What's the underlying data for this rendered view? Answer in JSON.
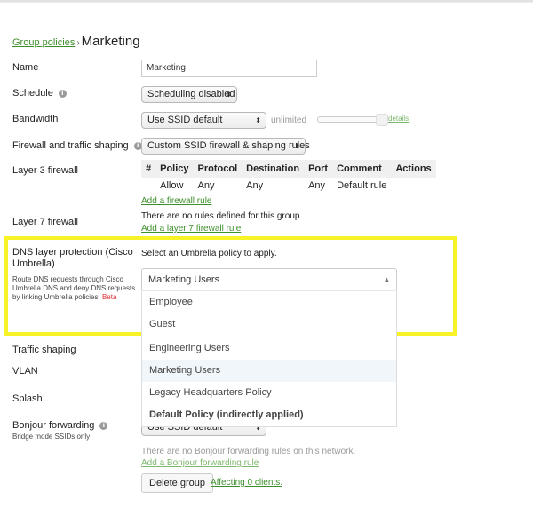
{
  "breadcrumb": {
    "parent_link": "Group policies",
    "separator": "›",
    "current": "Marketing"
  },
  "fields": {
    "name": {
      "label": "Name",
      "value": "Marketing"
    },
    "schedule": {
      "label": "Schedule",
      "value": "Scheduling disabled"
    },
    "bandwidth": {
      "label": "Bandwidth",
      "value": "Use SSID default",
      "limit_text": "unlimited",
      "details_link": "details"
    },
    "firewall_shaping": {
      "label": "Firewall and traffic shaping",
      "value": "Custom SSID firewall & shaping rules"
    },
    "layer3": {
      "label": "Layer 3 firewall",
      "columns": [
        "#",
        "Policy",
        "Protocol",
        "Destination",
        "Port",
        "Comment",
        "Actions"
      ],
      "rows": [
        [
          "",
          "Allow",
          "Any",
          "Any",
          "Any",
          "Default rule",
          ""
        ]
      ],
      "add_link": "Add a firewall rule"
    },
    "layer7": {
      "label": "Layer 7 firewall",
      "empty_text": "There are no rules defined for this group.",
      "add_link": "Add a layer 7 firewall rule"
    },
    "dns": {
      "label": "DNS layer protection (Cisco Umbrella)",
      "description": "Route DNS requests through Cisco Umbrella DNS and deny DNS requests by linking Umbrella policies.",
      "badge": "Beta",
      "prompt": "Select an Umbrella policy to apply.",
      "selected": "Marketing Users",
      "options": [
        "Employee",
        "Guest",
        "Engineering Users",
        "Marketing Users",
        "Legacy Headquarters Policy",
        "Default Policy (indirectly applied)"
      ]
    },
    "traffic_shaping": {
      "label": "Traffic shaping"
    },
    "vlan": {
      "label": "VLAN"
    },
    "splash": {
      "label": "Splash"
    },
    "bonjour": {
      "label": "Bonjour forwarding",
      "sublabel": "Bridge mode SSIDs only",
      "value": "Use SSID default",
      "empty_text": "There are no Bonjour forwarding rules on this network.",
      "add_link": "Add a Bonjour forwarding rule"
    }
  },
  "footer": {
    "delete_button": "Delete group",
    "affecting_link": "Affecting 0 clients."
  },
  "colors": {
    "link": "#3d8f2b",
    "highlight": "#f7f326",
    "beta": "#e03030"
  }
}
